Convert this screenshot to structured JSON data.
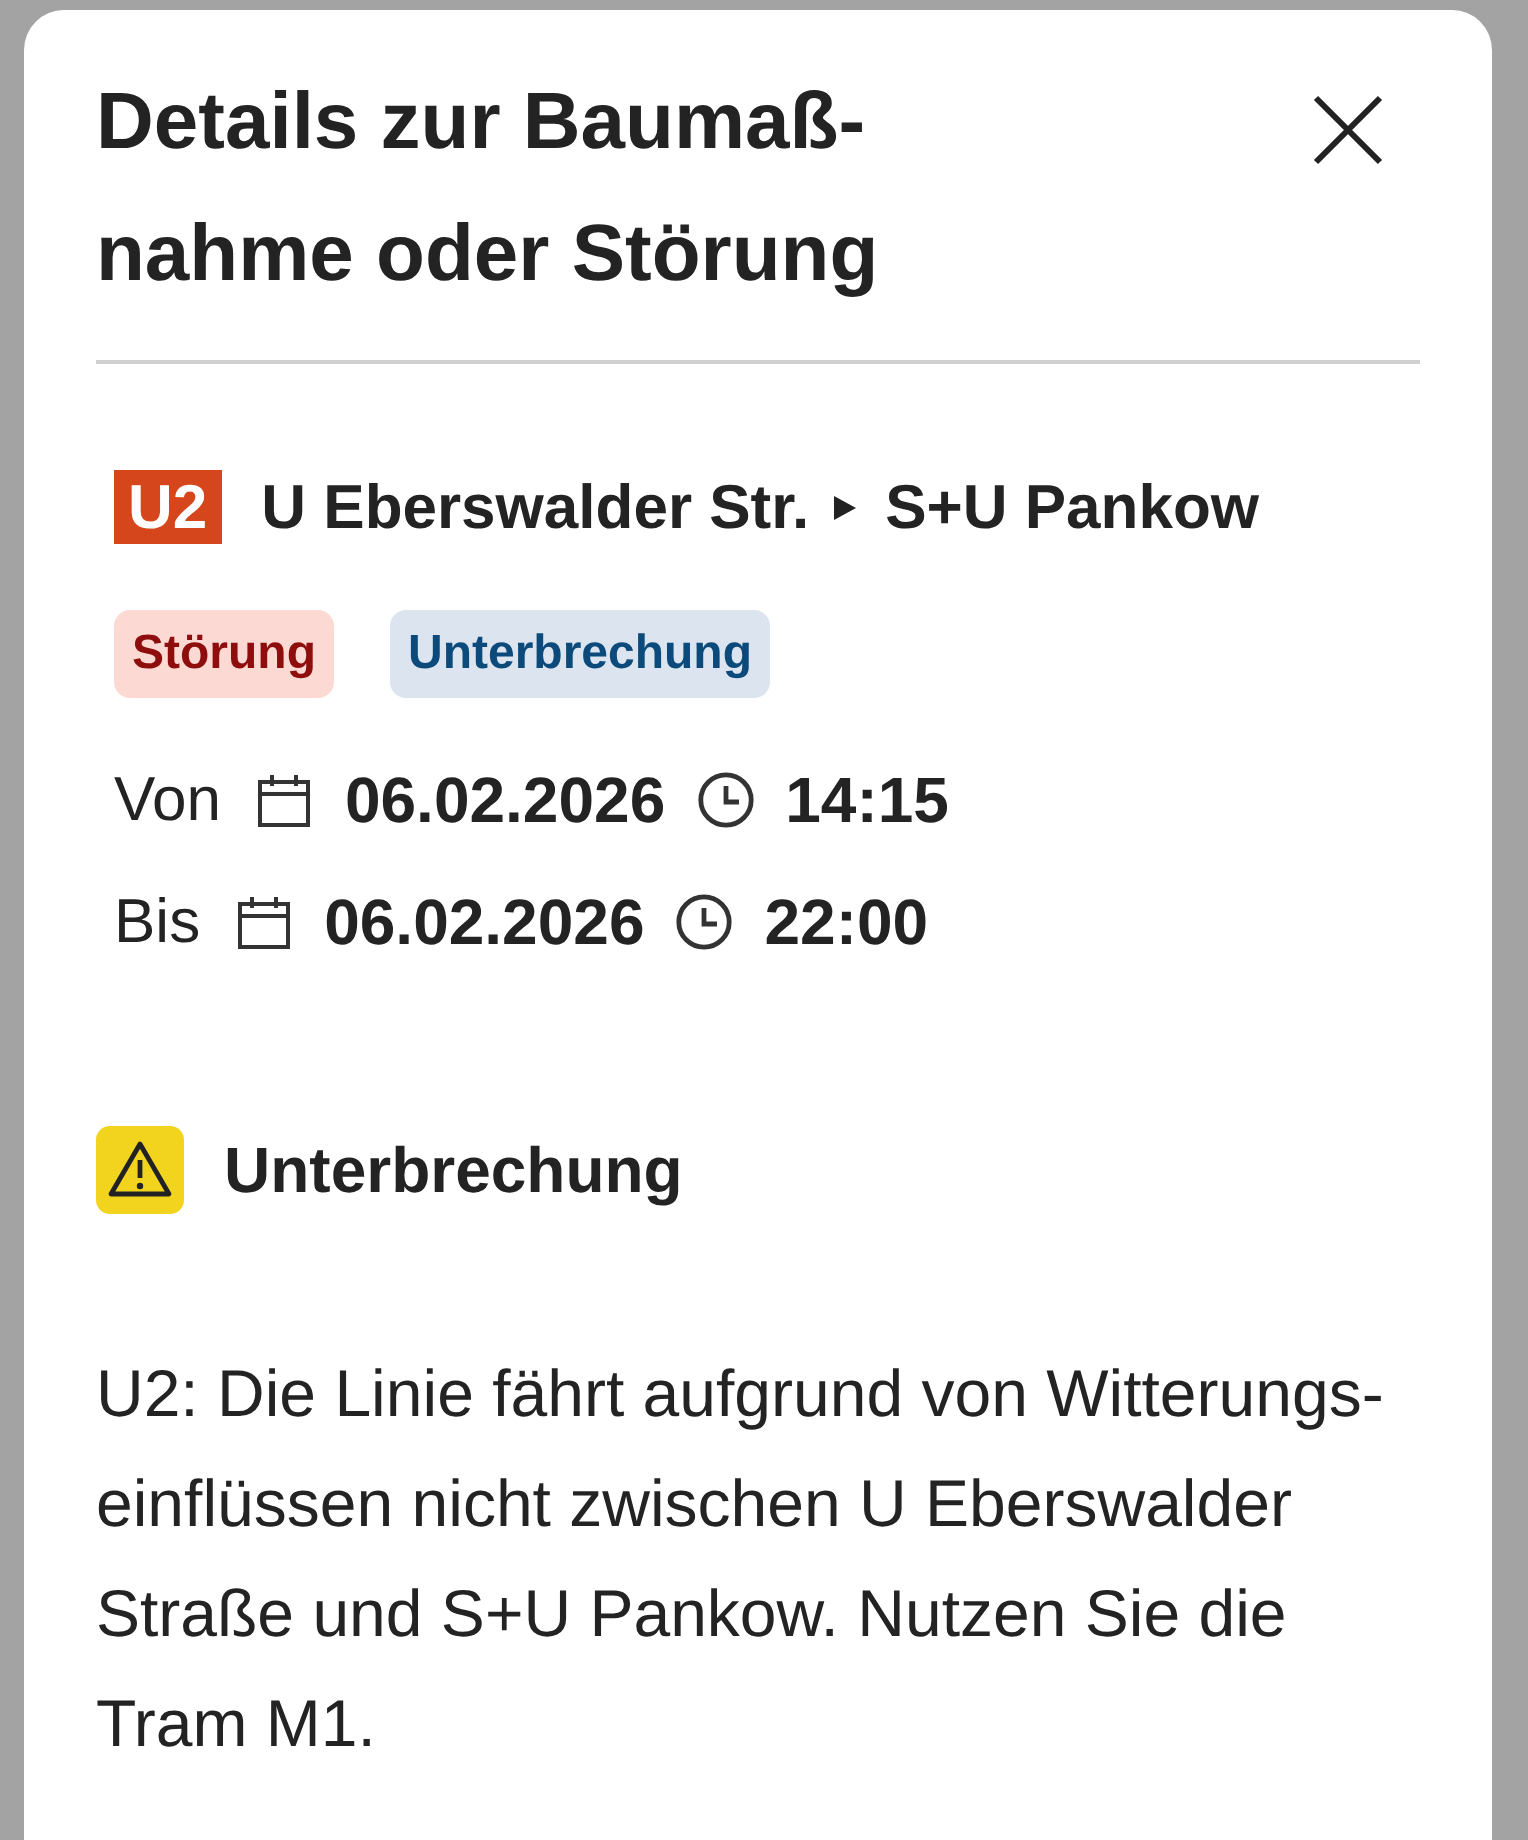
{
  "dialog": {
    "title": "Details zur Baumaß-nahme oder Störung"
  },
  "route": {
    "line": "U2",
    "from": "U Eberswalder Str.",
    "to": "S+U Pankow"
  },
  "tags": [
    {
      "label": "Störung",
      "kind": "disruption"
    },
    {
      "label": "Unterbrechung",
      "kind": "interruption"
    }
  ],
  "period": [
    {
      "label": "Von",
      "date": "06.02.2026",
      "time": "14:15"
    },
    {
      "label": "Bis",
      "date": "06.02.2026",
      "time": "22:00"
    }
  ],
  "notice": {
    "kind": "warning",
    "title": "Unterbrechung",
    "text": "U2: Die Linie fährt aufgrund von Witterungs-einflüssen nicht zwischen U Eberswalder Straße und S+U Pankow. Nutzen Sie die Tram M1."
  }
}
